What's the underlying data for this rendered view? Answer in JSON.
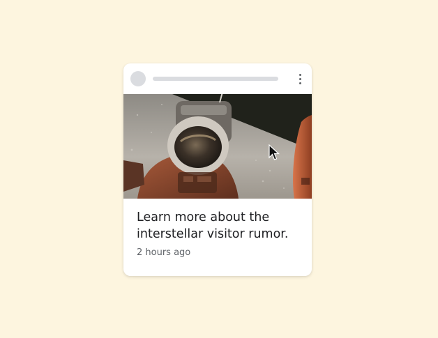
{
  "card": {
    "headline": "Learn more about the interstellar visitor rumor.",
    "timestamp": "2 hours ago",
    "menu_icon": "more-vert-icon",
    "image_subject": "astronaut-on-moon-image"
  },
  "colors": {
    "background": "#fdf5df",
    "card": "#ffffff",
    "placeholder": "#dadce0",
    "headline_text": "#202124",
    "meta_text": "#5f6368"
  },
  "pointer": {
    "icon": "mouse-cursor-icon"
  }
}
